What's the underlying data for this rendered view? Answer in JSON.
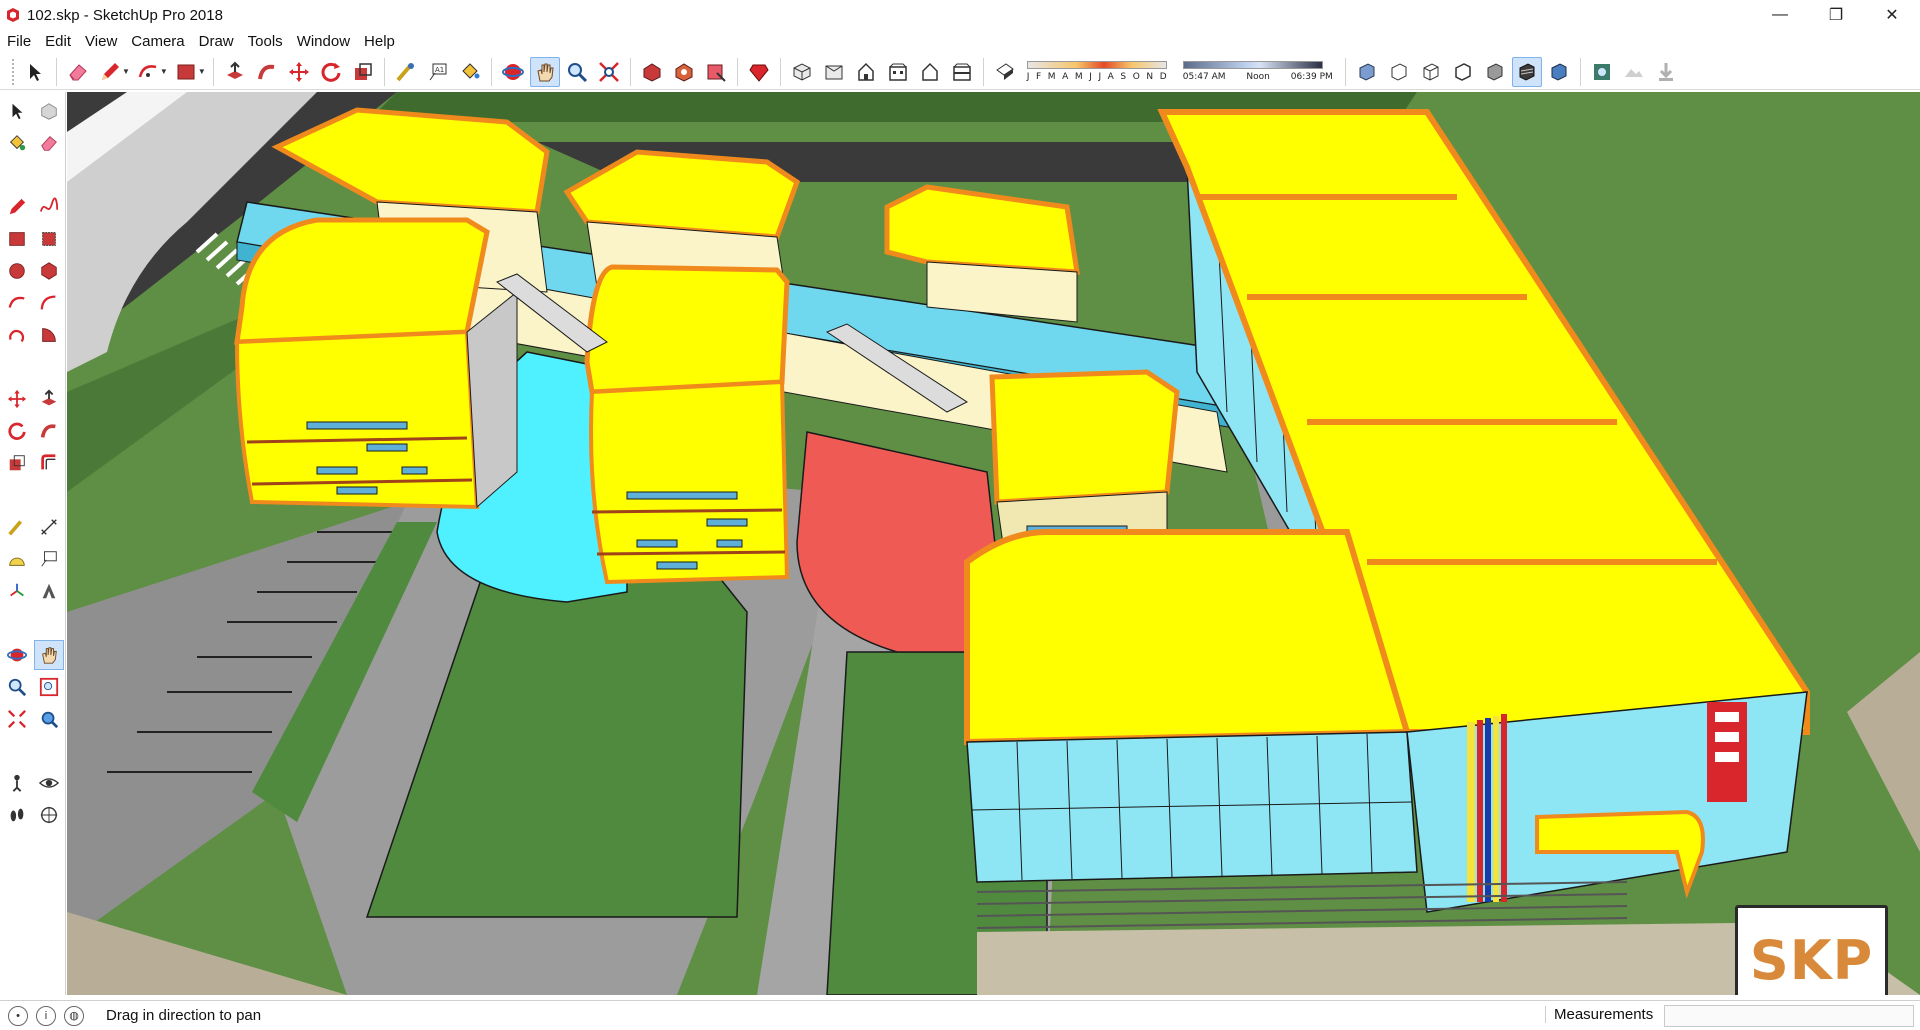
{
  "window": {
    "title": "102.skp - SketchUp Pro 2018",
    "controls": {
      "minimize": "—",
      "restore": "❐",
      "close": "✕"
    }
  },
  "menu": [
    "File",
    "Edit",
    "View",
    "Camera",
    "Draw",
    "Tools",
    "Window",
    "Help"
  ],
  "toolbar": {
    "tools": [
      "select-icon",
      "eraser-icon",
      "pencil-icon",
      "arc-icon",
      "rectangle-icon",
      "push-pull-icon",
      "follow-me-icon",
      "move-icon",
      "rotate-icon",
      "scale-icon",
      "tape-measure-icon",
      "text-icon",
      "paint-bucket-icon",
      "orbit-icon",
      "pan-icon",
      "zoom-icon",
      "zoom-extents-icon",
      "warehouse-icon",
      "extension-warehouse-icon",
      "layout-icon",
      "ruby-icon",
      "iso-view-icon",
      "top-view-icon",
      "front-view-icon",
      "right-view-icon",
      "back-view-icon",
      "left-view-icon"
    ],
    "active_tool": "pan-icon",
    "shadow": {
      "months": [
        "J",
        "F",
        "M",
        "A",
        "M",
        "J",
        "J",
        "A",
        "S",
        "O",
        "N",
        "D"
      ],
      "time_start": "05:47 AM",
      "time_mid": "Noon",
      "time_end": "06:39 PM"
    }
  },
  "status": {
    "message": "Drag in direction to pan",
    "measurements_label": "Measurements",
    "measurements_value": ""
  },
  "watermark": "SKP",
  "colors": {
    "roof_yellow": "#ffff00",
    "trim_orange": "#f08a1c",
    "glass_cyan": "#8ee6f5",
    "plaza_cyan": "#4ff0ff",
    "plaza_red": "#f05a55",
    "grass_green": "#4f8a3f",
    "road_dark": "#3a3a3a",
    "paving_gray": "#9a9a9a"
  }
}
